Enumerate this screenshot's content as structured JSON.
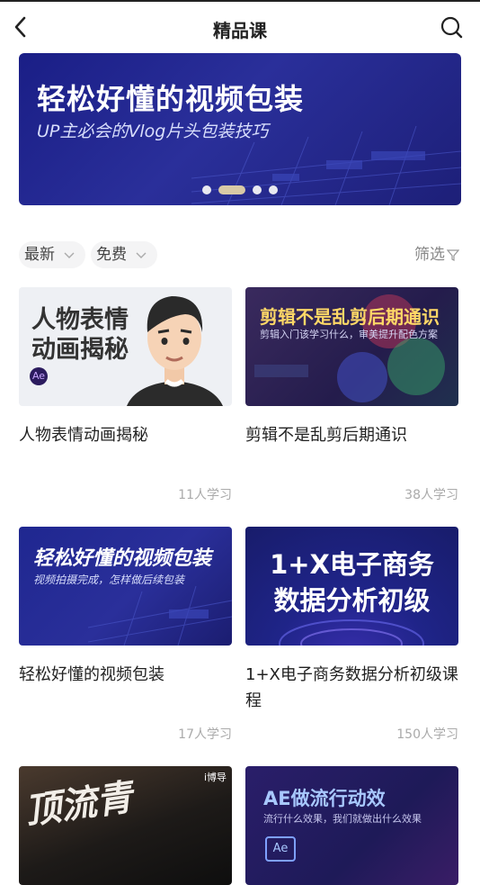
{
  "header": {
    "title": "精品课"
  },
  "banner": {
    "title": "轻松好懂的视频包装",
    "subtitle": "UP主必会的Vlog片头包装技巧",
    "dots": 4,
    "active_dot": 2
  },
  "filters": {
    "sort": "最新",
    "price": "免费",
    "filter_label": "筛选"
  },
  "courses": [
    {
      "title": "人物表情动画揭秘",
      "count": "11人学习",
      "thumb_title": "人物表情\n动画揭秘",
      "thumb_badge": "Ae"
    },
    {
      "title": "剪辑不是乱剪后期通识",
      "count": "38人学习",
      "thumb_title": "剪辑不是乱剪后期通识",
      "thumb_sub": "剪辑入门该学习什么，审美提升配色方案"
    },
    {
      "title": "轻松好懂的视频包装",
      "count": "17人学习",
      "thumb_title": "轻松好懂的视频包装",
      "thumb_sub": "视频拍摄完成，怎样做后续包装"
    },
    {
      "title": "1+X电子商务数据分析初级课程",
      "count": "150人学习",
      "thumb_title": "1+X电子商务\n数据分析初级"
    },
    {
      "title": "",
      "count": "",
      "thumb_title": "顶流青",
      "thumb_logo": "i博导"
    },
    {
      "title": "",
      "count": "",
      "thumb_title": "AE做流行动效",
      "thumb_sub": "流行什么效果，我们就做出什么效果",
      "thumb_badge": "Ae"
    }
  ],
  "colors": {
    "banner_bg": "#1f2490",
    "dot_active": "#d8c9a6",
    "count_text": "#aaaaaa"
  }
}
